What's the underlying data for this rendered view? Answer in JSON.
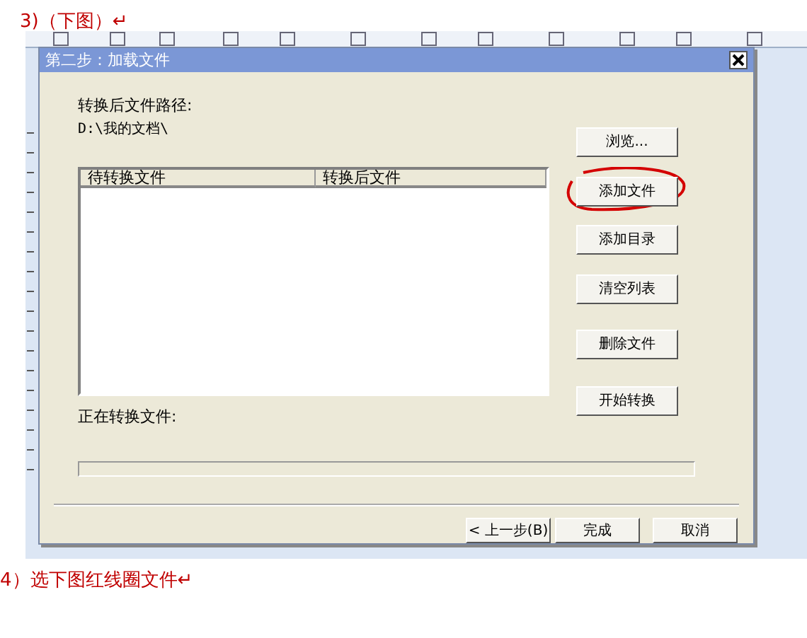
{
  "doc_caption_top": "3)（下图）↵",
  "dialog": {
    "title": "第二步：加载文件",
    "path_label": "转换后文件路径:",
    "path_value": "D:\\我的文档\\",
    "list_columns": [
      "待转换文件",
      "转换后文件"
    ],
    "side_buttons": [
      {
        "label": "浏览...",
        "circled": false
      },
      {
        "label": "添加文件",
        "circled": true
      },
      {
        "label": "添加目录",
        "circled": false
      },
      {
        "label": "清空列表",
        "circled": false
      },
      {
        "label": "删除文件",
        "circled": false
      },
      {
        "label": "开始转换",
        "circled": false
      }
    ],
    "status_label": "正在转换文件:",
    "progress": {
      "level": 0
    },
    "footer_buttons": [
      "< 上一步(B)",
      "完成",
      "取消"
    ]
  },
  "doc_caption_bottom": "4）选下图红线圈文件↵"
}
